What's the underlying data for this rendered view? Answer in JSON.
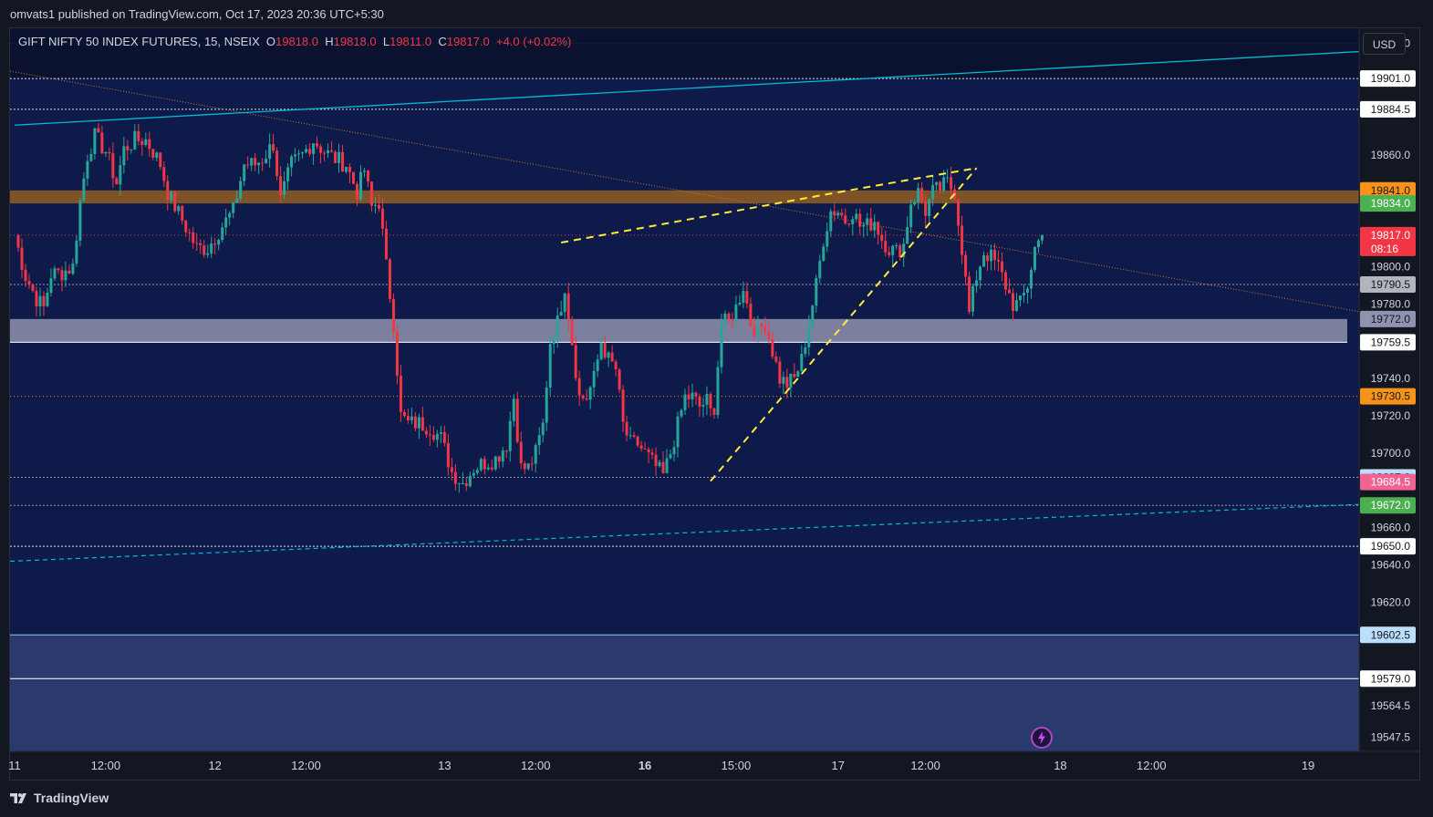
{
  "header": {
    "publisher": "omvats1 published on TradingView.com, Oct 17, 2023 20:36 UTC+5:30"
  },
  "legend": {
    "symbol": "GIFT NIFTY 50 INDEX FUTURES, 15, NSEIX",
    "o_label": "O",
    "o_value": "19818.0",
    "h_label": "H",
    "h_value": "19818.0",
    "l_label": "L",
    "l_value": "19811.0",
    "c_label": "C",
    "c_value": "19817.0",
    "change": "+4.0 (+0.02%)"
  },
  "currency_button": "USD",
  "brand": {
    "name": "TradingView"
  },
  "icons": {
    "logo": "tradingview-logo-icon",
    "alert": "lightning-icon"
  },
  "colors": {
    "background": "#131722",
    "up": "#26a69a",
    "down": "#f23645",
    "zone_dark": "#0b1230",
    "zone_mid": "#0e1a4a",
    "zone_light": "#2a3a6e",
    "support_band": "#8f93ad",
    "resistance_band": "#8b5a24",
    "trendline": "#00bcd4",
    "pattern": "#ffeb3b"
  },
  "chart_data": {
    "type": "candlestick",
    "symbol": "GIFT NIFTY 50 INDEX FUTURES",
    "interval": "15",
    "exchange": "NSEIX",
    "ylim": [
      19540,
      19928
    ],
    "price_ticks": [
      "19920.0",
      "19860.0",
      "19800.0",
      "19780.0",
      "19740.0",
      "19720.0",
      "19700.0",
      "19660.0",
      "19640.0",
      "19620.0",
      "19564.5",
      "19547.5"
    ],
    "price_labels": [
      {
        "value": "19901.0",
        "bg": "#ffffff",
        "fg": "#131722"
      },
      {
        "value": "19884.5",
        "bg": "#ffffff",
        "fg": "#131722"
      },
      {
        "value": "19841.0",
        "bg": "#f7931a",
        "fg": "#131722"
      },
      {
        "value": "19834.0",
        "bg": "#4caf50",
        "fg": "#ffffff"
      },
      {
        "value": "19817.0",
        "bg": "#f23645",
        "fg": "#ffffff",
        "sub": "08:16"
      },
      {
        "value": "19790.5",
        "bg": "#b2b5be",
        "fg": "#131722"
      },
      {
        "value": "19772.0",
        "bg": "#8f93ad",
        "fg": "#131722"
      },
      {
        "value": "19759.5",
        "bg": "#ffffff",
        "fg": "#131722"
      },
      {
        "value": "19730.5",
        "bg": "#f7931a",
        "fg": "#131722"
      },
      {
        "value": "19687.0",
        "bg": "#bbdefb",
        "fg": "#131722"
      },
      {
        "value": "19684.5",
        "bg": "#f06292",
        "fg": "#ffffff"
      },
      {
        "value": "19672.0",
        "bg": "#4caf50",
        "fg": "#ffffff"
      },
      {
        "value": "19650.0",
        "bg": "#ffffff",
        "fg": "#131722"
      },
      {
        "value": "19602.5",
        "bg": "#bbdefb",
        "fg": "#131722"
      },
      {
        "value": "19579.0",
        "bg": "#ffffff",
        "fg": "#131722"
      }
    ],
    "time_labels": [
      {
        "t": 0,
        "label": "11",
        "bold": false
      },
      {
        "t": 25,
        "label": "12:00",
        "bold": false
      },
      {
        "t": 55,
        "label": "12",
        "bold": false
      },
      {
        "t": 80,
        "label": "12:00",
        "bold": false
      },
      {
        "t": 118,
        "label": "13",
        "bold": false
      },
      {
        "t": 143,
        "label": "12:00",
        "bold": false
      },
      {
        "t": 173,
        "label": "16",
        "bold": true
      },
      {
        "t": 198,
        "label": "15:00",
        "bold": false
      },
      {
        "t": 226,
        "label": "17",
        "bold": false
      },
      {
        "t": 250,
        "label": "12:00",
        "bold": false
      },
      {
        "t": 287,
        "label": "18",
        "bold": false
      },
      {
        "t": 312,
        "label": "12:00",
        "bold": false
      },
      {
        "t": 355,
        "label": "19",
        "bold": false
      }
    ],
    "candle_path": [
      [
        0,
        19817
      ],
      [
        3,
        19795
      ],
      [
        6,
        19783
      ],
      [
        8,
        19778
      ],
      [
        10,
        19796
      ],
      [
        13,
        19797
      ],
      [
        16,
        19800
      ],
      [
        18,
        19835
      ],
      [
        20,
        19860
      ],
      [
        22,
        19870
      ],
      [
        25,
        19862
      ],
      [
        28,
        19845
      ],
      [
        30,
        19863
      ],
      [
        33,
        19868
      ],
      [
        36,
        19868
      ],
      [
        38,
        19862
      ],
      [
        40,
        19855
      ],
      [
        42,
        19840
      ],
      [
        46,
        19825
      ],
      [
        50,
        19810
      ],
      [
        53,
        19810
      ],
      [
        57,
        19822
      ],
      [
        60,
        19830
      ],
      [
        63,
        19855
      ],
      [
        66,
        19855
      ],
      [
        68,
        19858
      ],
      [
        71,
        19866
      ],
      [
        73,
        19836
      ],
      [
        76,
        19855
      ],
      [
        79,
        19860
      ],
      [
        82,
        19868
      ],
      [
        85,
        19862
      ],
      [
        88,
        19858
      ],
      [
        91,
        19855
      ],
      [
        94,
        19840
      ],
      [
        96,
        19852
      ],
      [
        98,
        19832
      ],
      [
        100,
        19835
      ],
      [
        102,
        19800
      ],
      [
        104,
        19770
      ],
      [
        106,
        19720
      ],
      [
        108,
        19716
      ],
      [
        111,
        19716
      ],
      [
        114,
        19714
      ],
      [
        117,
        19708
      ],
      [
        120,
        19690
      ],
      [
        123,
        19684
      ],
      [
        126,
        19692
      ],
      [
        129,
        19695
      ],
      [
        132,
        19697
      ],
      [
        135,
        19705
      ],
      [
        137,
        19730
      ],
      [
        139,
        19692
      ],
      [
        141,
        19692
      ],
      [
        143,
        19700
      ],
      [
        145,
        19715
      ],
      [
        147,
        19760
      ],
      [
        149,
        19770
      ],
      [
        151,
        19790
      ],
      [
        153,
        19760
      ],
      [
        155,
        19730
      ],
      [
        157,
        19730
      ],
      [
        159,
        19740
      ],
      [
        161,
        19760
      ],
      [
        163,
        19750
      ],
      [
        165,
        19745
      ],
      [
        167,
        19715
      ],
      [
        169,
        19705
      ],
      [
        171,
        19705
      ],
      [
        173,
        19700
      ],
      [
        175,
        19695
      ],
      [
        178,
        19688
      ],
      [
        180,
        19700
      ],
      [
        182,
        19715
      ],
      [
        184,
        19730
      ],
      [
        186,
        19730
      ],
      [
        188,
        19725
      ],
      [
        190,
        19728
      ],
      [
        191,
        19722
      ],
      [
        192,
        19725
      ],
      [
        194,
        19770
      ],
      [
        196,
        19770
      ],
      [
        198,
        19778
      ],
      [
        200,
        19790
      ],
      [
        202,
        19770
      ],
      [
        204,
        19765
      ],
      [
        206,
        19770
      ],
      [
        208,
        19755
      ],
      [
        210,
        19740
      ],
      [
        212,
        19737
      ],
      [
        214,
        19740
      ],
      [
        216,
        19750
      ],
      [
        218,
        19770
      ],
      [
        220,
        19790
      ],
      [
        222,
        19815
      ],
      [
        224,
        19830
      ],
      [
        226,
        19830
      ],
      [
        228,
        19825
      ],
      [
        230,
        19830
      ],
      [
        232,
        19822
      ],
      [
        234,
        19822
      ],
      [
        236,
        19825
      ],
      [
        238,
        19815
      ],
      [
        240,
        19810
      ],
      [
        242,
        19808
      ],
      [
        244,
        19812
      ],
      [
        246,
        19835
      ],
      [
        248,
        19840
      ],
      [
        250,
        19830
      ],
      [
        252,
        19840
      ],
      [
        254,
        19842
      ],
      [
        256,
        19845
      ],
      [
        258,
        19840
      ],
      [
        260,
        19810
      ],
      [
        262,
        19775
      ],
      [
        264,
        19795
      ],
      [
        266,
        19808
      ],
      [
        268,
        19805
      ],
      [
        270,
        19800
      ],
      [
        272,
        19790
      ],
      [
        274,
        19780
      ],
      [
        276,
        19780
      ],
      [
        278,
        19790
      ],
      [
        280,
        19810
      ],
      [
        282,
        19817
      ]
    ]
  }
}
